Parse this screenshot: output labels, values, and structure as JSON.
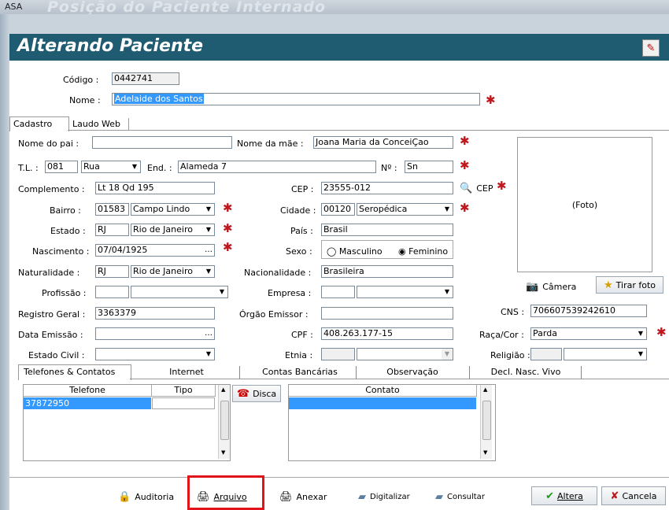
{
  "window": {
    "title": "ASA",
    "ghost_title": "Posição do Paciente Internado"
  },
  "banner": {
    "title": "Alterando Paciente",
    "pin_icon": "pin-icon"
  },
  "header": {
    "codigo_label": "Código :",
    "codigo_value": "0442741",
    "nome_label": "Nome :",
    "nome_value": "Adelaide dos Santos"
  },
  "tabs": {
    "cadastro": "Cadastro",
    "laudo": "Laudo Web"
  },
  "form": {
    "pai_label": "Nome do pai :",
    "pai_value": "",
    "mae_label": "Nome da mãe :",
    "mae_value": "Joana Maria da ConceiÇao",
    "tl_label": "T.L. :",
    "tl_code": "081",
    "tl_type": "Rua",
    "end_label": "End. :",
    "end_value": "Alameda 7",
    "num_label": "Nº :",
    "num_value": "Sn",
    "comp_label": "Complemento :",
    "comp_value": "Lt 18 Qd 195",
    "cep_label": "CEP :",
    "cep_value": "23555-012",
    "cep_btn": "CEP",
    "bairro_label": "Bairro :",
    "bairro_code": "01583",
    "bairro_name": "Campo Lindo",
    "cidade_label": "Cidade :",
    "cidade_code": "00120",
    "cidade_name": "Seropédica",
    "estado_label": "Estado :",
    "estado_code": "RJ",
    "estado_name": "Rio de Janeiro",
    "pais_label": "País :",
    "pais_value": "Brasil",
    "nasc_label": "Nascimento :",
    "nasc_value": "07/04/1925",
    "sexo_label": "Sexo :",
    "sexo_m": "Masculino",
    "sexo_f": "Feminino",
    "nat_label": "Naturalidade :",
    "nat_code": "RJ",
    "nat_name": "Rio de Janeiro",
    "nac_label": "Nacionalidade :",
    "nac_value": "Brasileira",
    "prof_label": "Profissão :",
    "empresa_label": "Empresa :",
    "rg_label": "Registro Geral :",
    "rg_value": "3363379",
    "orgao_label": "Órgão Emissor :",
    "cns_label": "CNS :",
    "cns_value": "706607539242610",
    "data_label": "Data Emissão :",
    "cpf_label": "CPF :",
    "cpf_value": "408.263.177-15",
    "raca_label": "Raça/Cor :",
    "raca_value": "Parda",
    "civil_label": "Estado Civil :",
    "etnia_label": "Etnia :",
    "religiao_label": "Religião :",
    "foto_label": "(Foto)",
    "camera_btn": "Câmera",
    "tirar_btn": "Tirar foto"
  },
  "contact_tabs": [
    "Telefones & Contatos",
    "Internet",
    "Contas Bancárias",
    "Observação",
    "Decl. Nasc. Vivo"
  ],
  "phones": {
    "col_telefone": "Telefone",
    "col_tipo": "Tipo",
    "rows": [
      {
        "telefone": "37872950",
        "tipo": ""
      }
    ],
    "disca_btn": "Disca",
    "col_contato": "Contato"
  },
  "footer": {
    "auditoria": "Auditoria",
    "arquivo": "Arquivo",
    "anexar": "Anexar",
    "digitalizar": "Digitalizar",
    "consultar": "Consultar",
    "altera": "Altera",
    "cancela": "Cancela"
  },
  "colors": {
    "banner": "#1f5c72",
    "required": "#c0161d",
    "highlight": "#e3131b",
    "selection": "#3399ff"
  }
}
